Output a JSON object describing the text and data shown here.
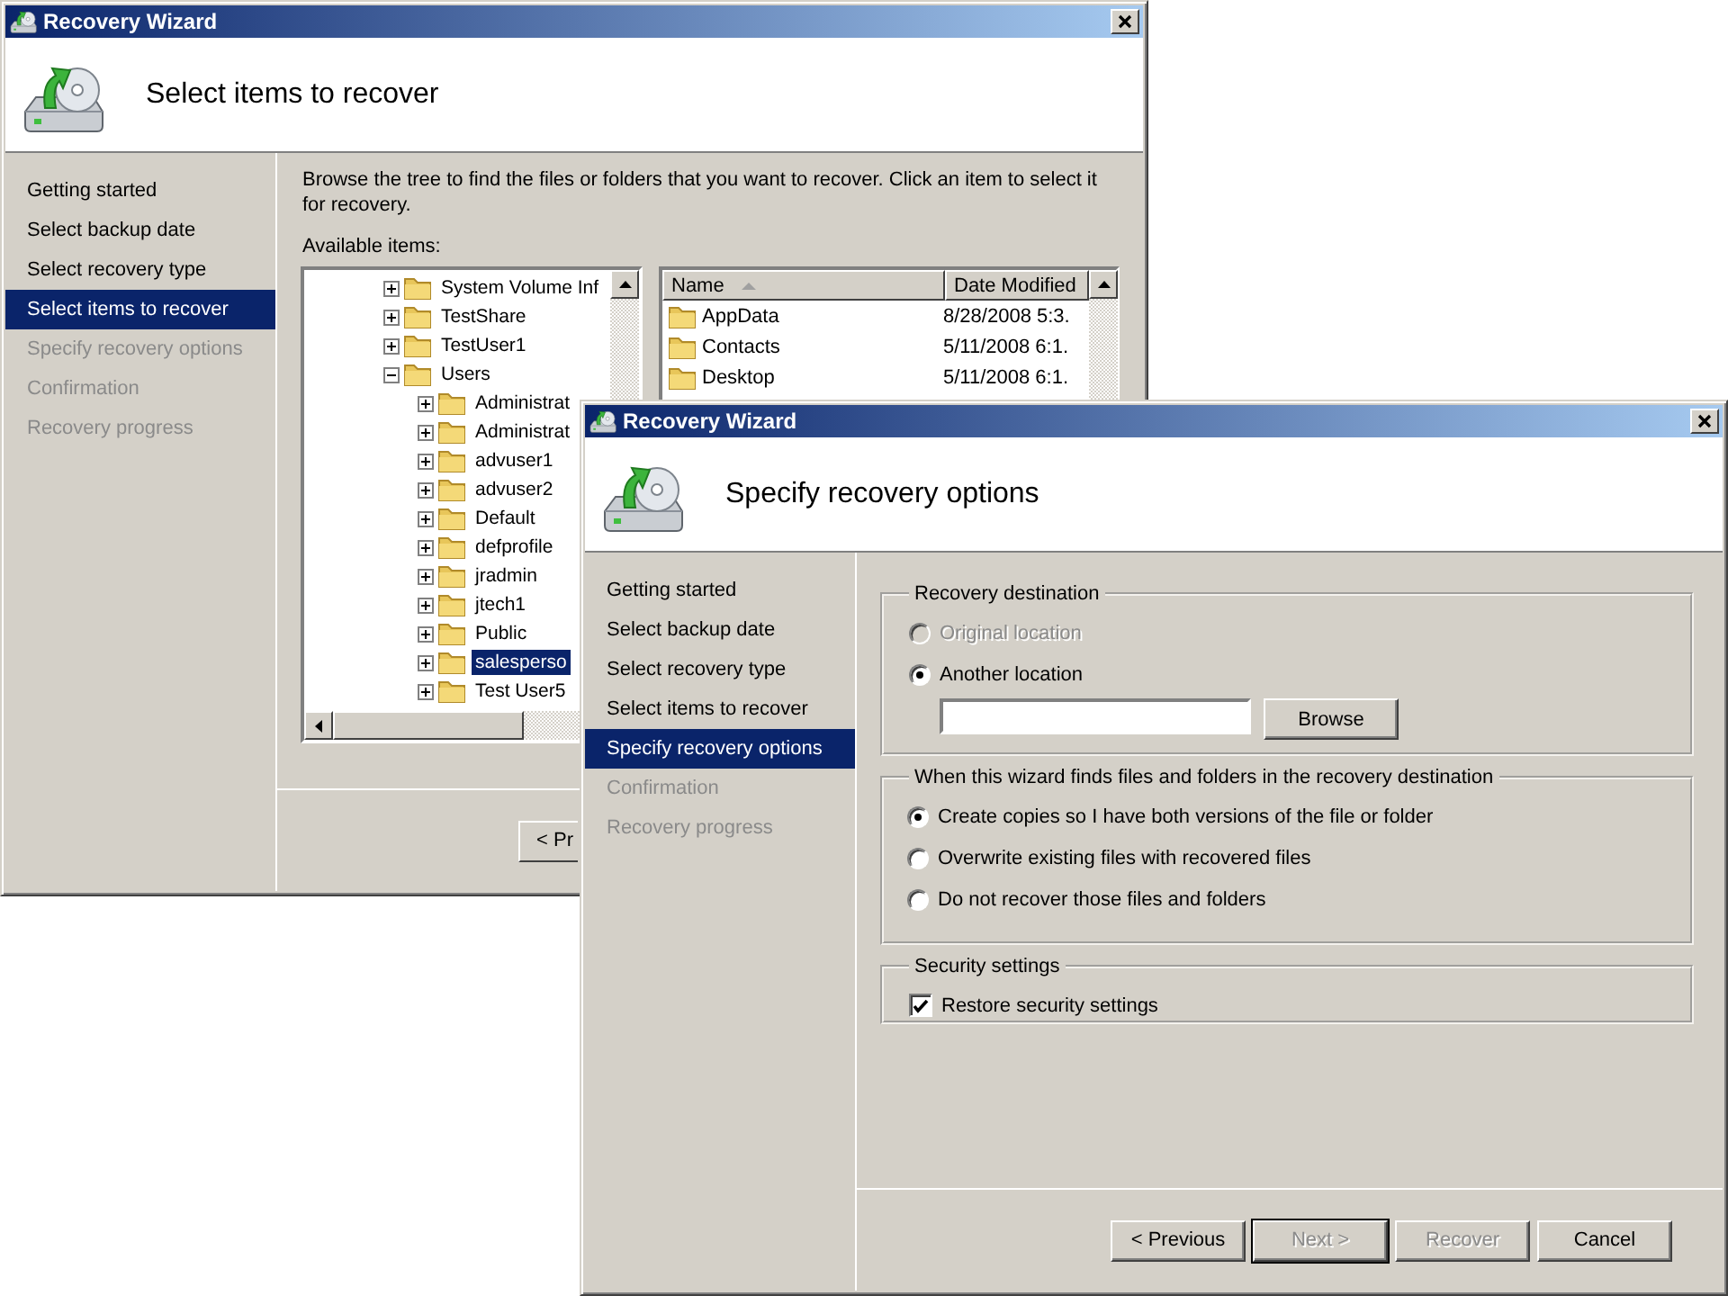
{
  "windows": [
    {
      "title": "Recovery Wizard",
      "heading": "Select items to recover",
      "steps": [
        {
          "label": "Getting started",
          "selected": false,
          "disabled": false
        },
        {
          "label": "Select backup date",
          "selected": false,
          "disabled": false
        },
        {
          "label": "Select recovery type",
          "selected": false,
          "disabled": false
        },
        {
          "label": "Select items to recover",
          "selected": true,
          "disabled": false
        },
        {
          "label": "Specify recovery options",
          "selected": false,
          "disabled": true
        },
        {
          "label": "Confirmation",
          "selected": false,
          "disabled": true
        },
        {
          "label": "Recovery progress",
          "selected": false,
          "disabled": true
        }
      ],
      "page": {
        "kind": "browse",
        "description": "Browse the tree to find the files or folders that you want to recover. Click an item to select it for recovery.",
        "items_label": "Available items:",
        "tree": [
          {
            "label": "System Volume Inf",
            "expanded": false,
            "selected": false
          },
          {
            "label": "TestShare",
            "expanded": false,
            "selected": false
          },
          {
            "label": "TestUser1",
            "expanded": false,
            "selected": false
          },
          {
            "label": "Users",
            "expanded": true,
            "selected": false,
            "children": [
              {
                "label": "Administrat",
                "expanded": false,
                "selected": false
              },
              {
                "label": "Administrat",
                "expanded": false,
                "selected": false
              },
              {
                "label": "advuser1",
                "expanded": false,
                "selected": false
              },
              {
                "label": "advuser2",
                "expanded": false,
                "selected": false
              },
              {
                "label": "Default",
                "expanded": false,
                "selected": false
              },
              {
                "label": "defprofile",
                "expanded": false,
                "selected": false
              },
              {
                "label": "jradmin",
                "expanded": false,
                "selected": false
              },
              {
                "label": "jtech1",
                "expanded": false,
                "selected": false
              },
              {
                "label": "Public",
                "expanded": false,
                "selected": false
              },
              {
                "label": "salesperso",
                "expanded": false,
                "selected": true
              },
              {
                "label": "Test User5",
                "expanded": false,
                "selected": false
              }
            ]
          }
        ],
        "list": {
          "columns": [
            {
              "label": "Name",
              "sorted": true
            },
            {
              "label": "Date Modified",
              "sorted": false
            }
          ],
          "rows": [
            {
              "name": "AppData",
              "date": "8/28/2008 5:3."
            },
            {
              "name": "Contacts",
              "date": "5/11/2008 6:1."
            },
            {
              "name": "Desktop",
              "date": "5/11/2008 6:1."
            }
          ]
        }
      },
      "buttons": [
        {
          "label": "< Pr",
          "disabled": false,
          "default": false
        }
      ]
    },
    {
      "title": "Recovery Wizard",
      "heading": "Specify recovery options",
      "steps": [
        {
          "label": "Getting started",
          "selected": false,
          "disabled": false
        },
        {
          "label": "Select backup date",
          "selected": false,
          "disabled": false
        },
        {
          "label": "Select recovery type",
          "selected": false,
          "disabled": false
        },
        {
          "label": "Select items to recover",
          "selected": false,
          "disabled": false
        },
        {
          "label": "Specify recovery options",
          "selected": true,
          "disabled": false
        },
        {
          "label": "Confirmation",
          "selected": false,
          "disabled": true
        },
        {
          "label": "Recovery progress",
          "selected": false,
          "disabled": true
        }
      ],
      "page": {
        "kind": "options",
        "groups": [
          {
            "title": "Recovery destination",
            "items": [
              {
                "kind": "radio",
                "label": "Original location",
                "selected": false,
                "disabled": true
              },
              {
                "kind": "radio",
                "label": "Another location",
                "selected": true,
                "disabled": false
              },
              {
                "kind": "path",
                "button": "Browse"
              }
            ]
          },
          {
            "title": "When this wizard finds files and folders in the recovery destination",
            "items": [
              {
                "kind": "radio",
                "label": "Create copies so I have both versions of the file or folder",
                "selected": true,
                "disabled": false
              },
              {
                "kind": "radio",
                "label": "Overwrite existing files with recovered files",
                "selected": false,
                "disabled": false
              },
              {
                "kind": "radio",
                "label": "Do not recover those files and folders",
                "selected": false,
                "disabled": false
              }
            ]
          },
          {
            "title": "Security settings",
            "items": [
              {
                "kind": "checkbox",
                "label": "Restore security settings",
                "checked": true,
                "disabled": false
              }
            ]
          }
        ]
      },
      "buttons": [
        {
          "label": "< Previous",
          "disabled": false,
          "default": false
        },
        {
          "label": "Next >",
          "disabled": true,
          "default": true
        },
        {
          "label": "Recover",
          "disabled": true,
          "default": false
        },
        {
          "label": "Cancel",
          "disabled": false,
          "default": false
        }
      ]
    }
  ]
}
